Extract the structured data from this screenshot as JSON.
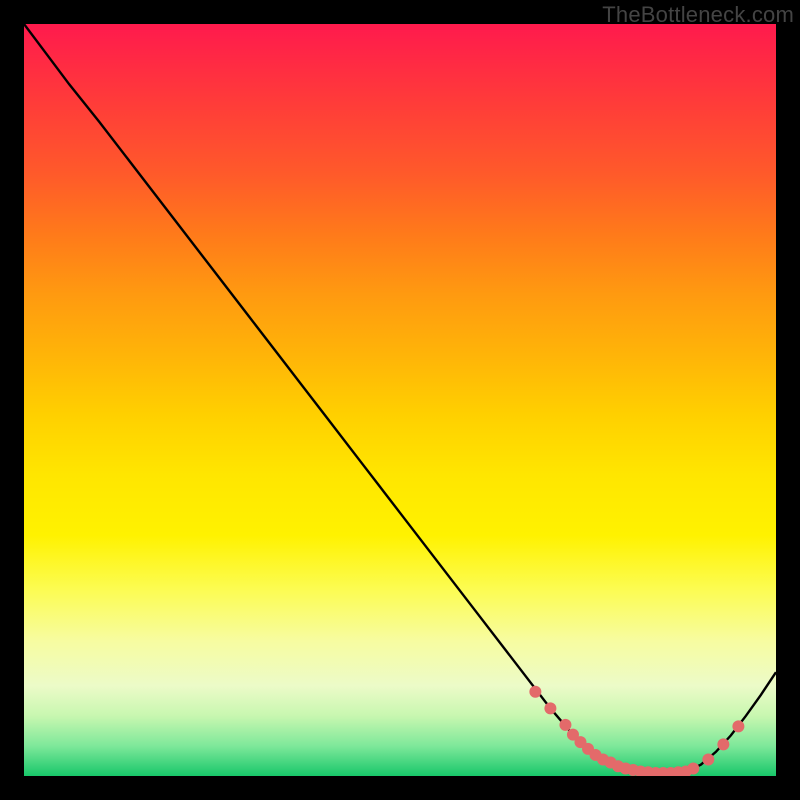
{
  "watermark": "TheBottleneck.com",
  "colors": {
    "curve_stroke": "#000000",
    "marker_fill": "#e36a6a",
    "marker_stroke": "#e36a6a"
  },
  "chart_data": {
    "type": "line",
    "title": "",
    "xlabel": "",
    "ylabel": "",
    "xlim": [
      0,
      100
    ],
    "ylim": [
      0,
      100
    ],
    "grid": false,
    "legend": false,
    "series": [
      {
        "name": "curve",
        "x": [
          0,
          3,
          6,
          10,
          15,
          20,
          25,
          30,
          35,
          40,
          45,
          50,
          55,
          60,
          65,
          70,
          73,
          75,
          78,
          80,
          82,
          84,
          86,
          88,
          90,
          92,
          94,
          96,
          98,
          100
        ],
        "y": [
          100,
          96,
          92,
          87,
          80.5,
          74,
          67.5,
          61,
          54.5,
          48,
          41.5,
          35,
          28.5,
          22,
          15.5,
          9,
          5.5,
          3.6,
          1.8,
          1.0,
          0.6,
          0.4,
          0.4,
          0.6,
          1.5,
          3.2,
          5.4,
          8.0,
          10.8,
          13.8
        ]
      }
    ],
    "markers": {
      "name": "highlight-points",
      "x": [
        68,
        70,
        72,
        73,
        74,
        75,
        76,
        77,
        78,
        79,
        80,
        81,
        82,
        83,
        84,
        85,
        86,
        87,
        88,
        89,
        91,
        93,
        95
      ],
      "y": [
        11.2,
        9.0,
        6.8,
        5.5,
        4.5,
        3.6,
        2.8,
        2.2,
        1.8,
        1.3,
        1.0,
        0.8,
        0.6,
        0.5,
        0.4,
        0.4,
        0.4,
        0.5,
        0.6,
        1.0,
        2.2,
        4.2,
        6.6
      ]
    }
  }
}
